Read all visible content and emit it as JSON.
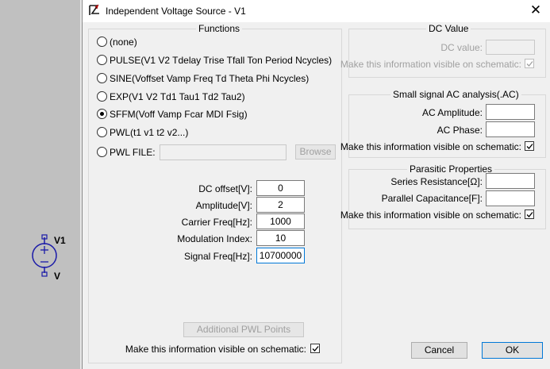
{
  "schematic": {
    "component_name": "V1",
    "component_value": "V"
  },
  "window": {
    "title": "Independent Voltage Source - V1",
    "close": "✕"
  },
  "functions": {
    "title": "Functions",
    "options": [
      {
        "label": "(none)",
        "selected": false
      },
      {
        "label": "PULSE(V1 V2 Tdelay Trise Tfall Ton Period Ncycles)",
        "selected": false
      },
      {
        "label": "SINE(Voffset Vamp Freq Td Theta Phi Ncycles)",
        "selected": false
      },
      {
        "label": "EXP(V1 V2 Td1 Tau1 Td2 Tau2)",
        "selected": false
      },
      {
        "label": "SFFM(Voff Vamp Fcar MDI Fsig)",
        "selected": true
      },
      {
        "label": "PWL(t1 v1 t2 v2...)",
        "selected": false
      },
      {
        "label": "PWL FILE:",
        "selected": false
      }
    ],
    "pwl_file_value": "",
    "browse_label": "Browse",
    "params": [
      {
        "label": "DC offset[V]:",
        "value": "0"
      },
      {
        "label": "Amplitude[V]:",
        "value": "2"
      },
      {
        "label": "Carrier Freq[Hz]:",
        "value": "1000"
      },
      {
        "label": "Modulation Index:",
        "value": "10"
      },
      {
        "label": "Signal Freq[Hz]:",
        "value": "10700000"
      }
    ],
    "additional_pwl_label": "Additional PWL Points",
    "visible_label": "Make this information visible on schematic:",
    "visible_checked": true
  },
  "dc_value": {
    "title": "DC Value",
    "label": "DC value:",
    "value": "",
    "visible_label": "Make this information visible on schematic:",
    "visible_checked": true
  },
  "ac": {
    "title": "Small signal AC analysis(.AC)",
    "amplitude_label": "AC Amplitude:",
    "amplitude_value": "",
    "phase_label": "AC Phase:",
    "phase_value": "",
    "visible_label": "Make this information visible on schematic:",
    "visible_checked": true
  },
  "parasitic": {
    "title": "Parasitic Properties",
    "series_label": "Series Resistance[Ω]:",
    "series_value": "",
    "parallel_label": "Parallel Capacitance[F]:",
    "parallel_value": "",
    "visible_label": "Make this information visible on schematic:",
    "visible_checked": true
  },
  "buttons": {
    "cancel": "Cancel",
    "ok": "OK"
  }
}
